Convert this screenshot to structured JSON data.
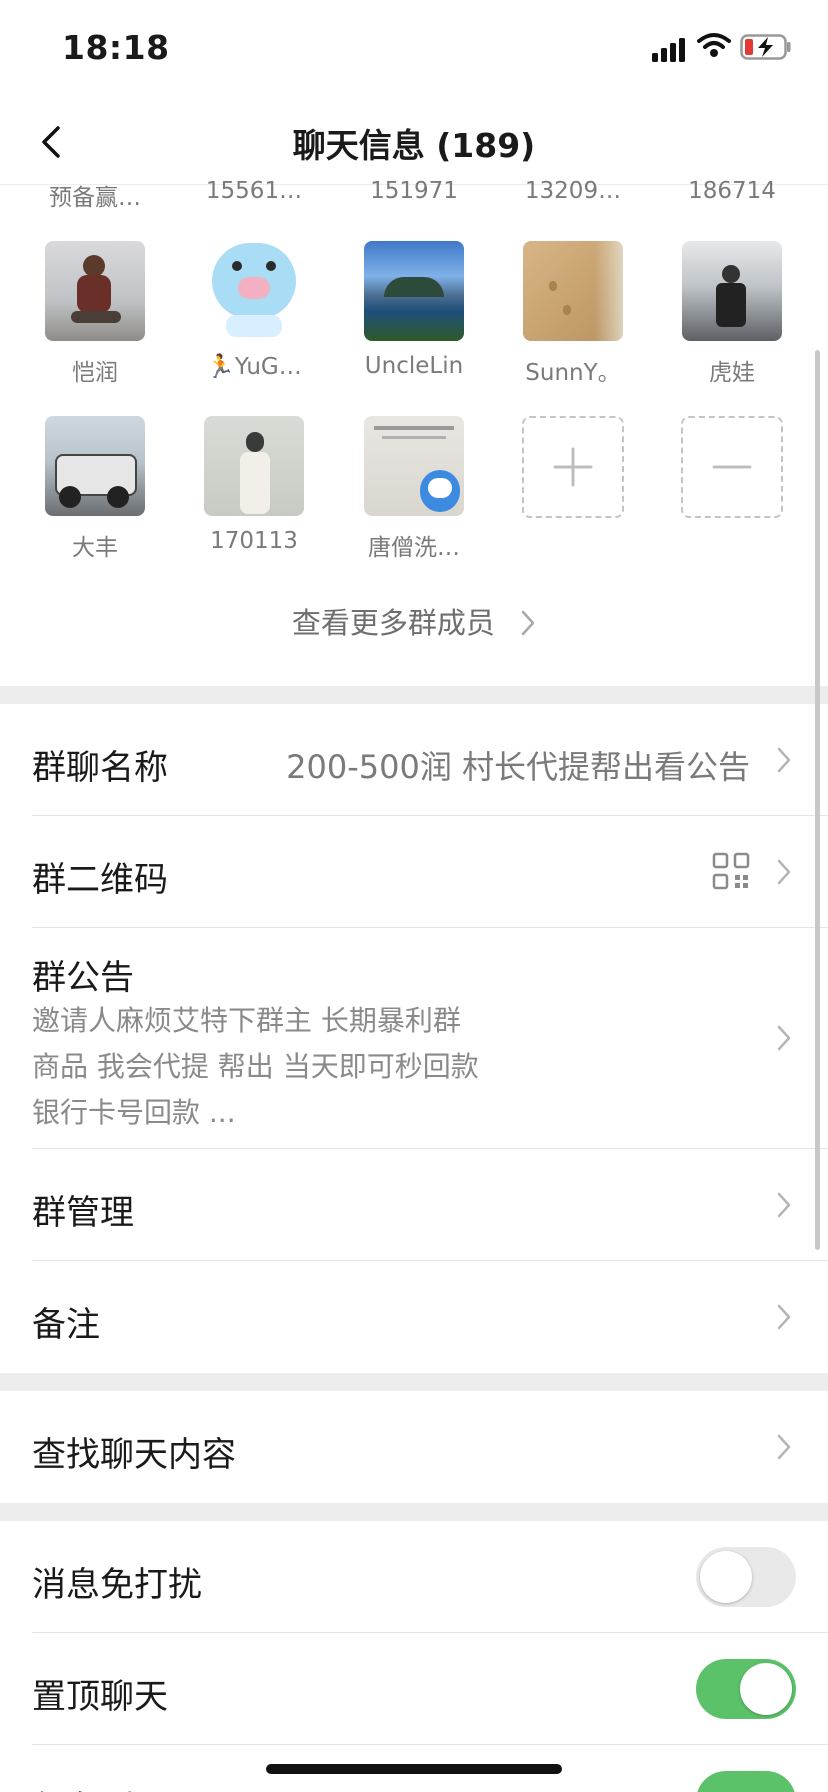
{
  "status_bar": {
    "time": "18:18"
  },
  "nav": {
    "title": "聊天信息 (189)"
  },
  "members": {
    "cut_row": [
      "预备赢…",
      "15561…",
      "151971",
      "13209…",
      "186714"
    ],
    "row1": [
      "恺润",
      "🏃YuG…",
      "UncleLin",
      "SunnY。",
      "虎娃"
    ],
    "row2": [
      "大丰",
      "170113",
      "唐僧洗…"
    ],
    "see_more": "查看更多群成员"
  },
  "settings": {
    "group_name": {
      "label": "群聊名称",
      "value": "200-500润 村长代提帮出看公告"
    },
    "qr_code": {
      "label": "群二维码"
    },
    "announcement": {
      "label": "群公告",
      "lines": [
        "邀请人麻烦艾特下群主 长期暴利群",
        "商品 我会代提 帮出 当天即可秒回款",
        "银行卡号回款 ..."
      ]
    },
    "management": {
      "label": "群管理"
    },
    "remark": {
      "label": "备注"
    },
    "search": {
      "label": "查找聊天内容"
    },
    "mute": {
      "label": "消息免打扰",
      "on": false
    },
    "pin": {
      "label": "置顶聊天",
      "on": true
    },
    "save_contacts": {
      "label": "保存到通讯录"
    }
  },
  "colors": {
    "toggle_on": "#5cc26a",
    "toggle_off": "#e9e9e9"
  }
}
